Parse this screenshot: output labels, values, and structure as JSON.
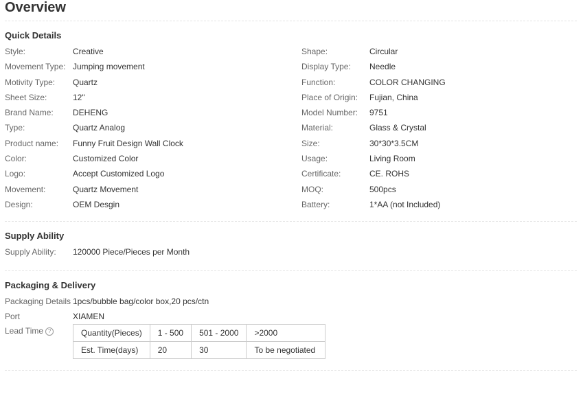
{
  "title": "Overview",
  "quick_details": {
    "heading": "Quick Details",
    "left": [
      {
        "label": "Style:",
        "value": "Creative"
      },
      {
        "label": "Movement Type:",
        "value": "Jumping movement"
      },
      {
        "label": "Motivity Type:",
        "value": "Quartz"
      },
      {
        "label": "Sheet Size:",
        "value": "12\""
      },
      {
        "label": "Brand Name:",
        "value": "DEHENG"
      },
      {
        "label": "Type:",
        "value": "Quartz Analog"
      },
      {
        "label": "Product name:",
        "value": "Funny Fruit Design Wall Clock"
      },
      {
        "label": "Color:",
        "value": "Customized Color"
      },
      {
        "label": "Logo:",
        "value": "Accept Customized Logo"
      },
      {
        "label": "Movement:",
        "value": "Quartz Movement"
      },
      {
        "label": "Design:",
        "value": "OEM Desgin"
      }
    ],
    "right": [
      {
        "label": "Shape:",
        "value": "Circular"
      },
      {
        "label": "Display Type:",
        "value": "Needle"
      },
      {
        "label": "Function:",
        "value": "COLOR CHANGING"
      },
      {
        "label": "Place of Origin:",
        "value": "Fujian, China"
      },
      {
        "label": "Model Number:",
        "value": "9751"
      },
      {
        "label": "Material:",
        "value": "Glass & Crystal"
      },
      {
        "label": "Size:",
        "value": "30*30*3.5CM"
      },
      {
        "label": "Usage:",
        "value": "Living Room"
      },
      {
        "label": "Certificate:",
        "value": "CE. ROHS"
      },
      {
        "label": "MOQ:",
        "value": "500pcs"
      },
      {
        "label": "Battery:",
        "value": "1*AA (not Included)"
      }
    ]
  },
  "supply_ability": {
    "heading": "Supply Ability",
    "label": "Supply Ability:",
    "value": "120000 Piece/Pieces per Month"
  },
  "packaging": {
    "heading": "Packaging & Delivery",
    "details_label": "Packaging Details",
    "details_value": "1pcs/bubble bag/color box,20 pcs/ctn",
    "port_label": "Port",
    "port_value": "XIAMEN",
    "lead_time_label": "Lead Time",
    "help_glyph": "?",
    "lead_table": {
      "rows": [
        [
          "Quantity(Pieces)",
          "1 - 500",
          "501 - 2000",
          ">2000"
        ],
        [
          "Est. Time(days)",
          "20",
          "30",
          "To be negotiated"
        ]
      ]
    }
  }
}
